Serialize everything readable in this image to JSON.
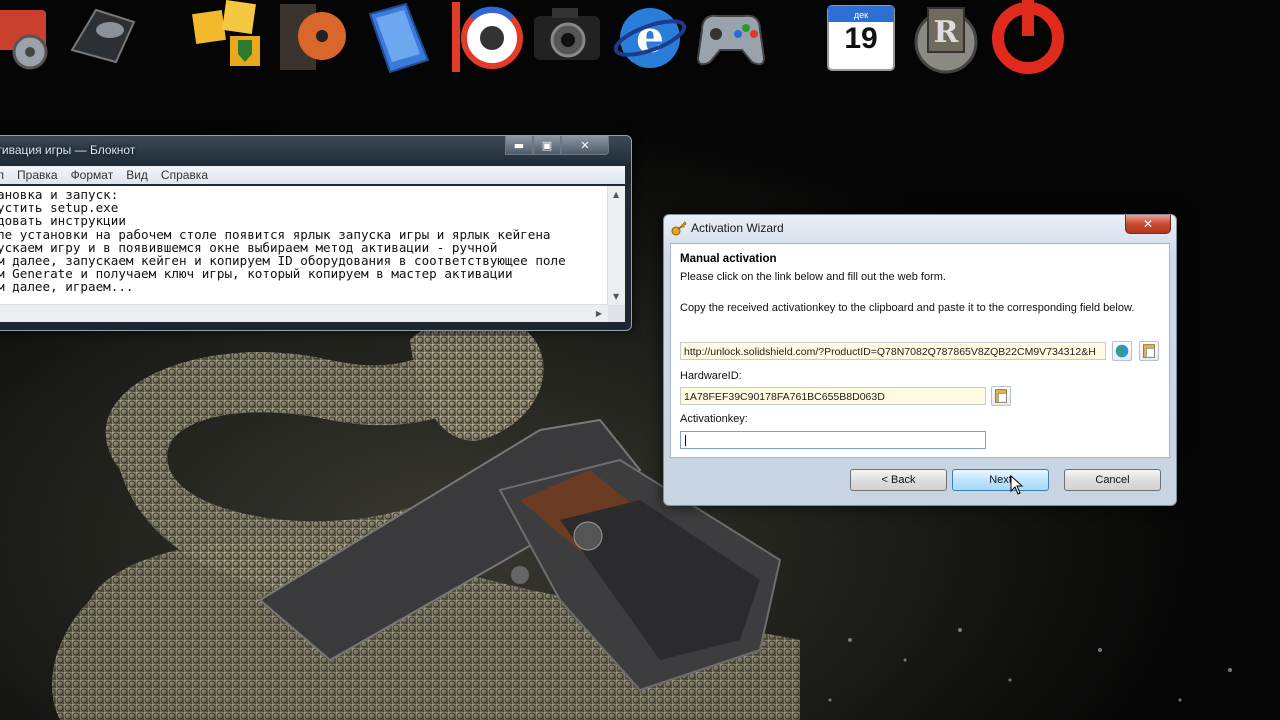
{
  "desktop": {
    "dock": [
      {
        "name": "system-tools-icon"
      },
      {
        "name": "disk-drive-icon"
      },
      {
        "name": "security-cubes-icon"
      },
      {
        "name": "dvd-burner-icon"
      },
      {
        "name": "documents-icon"
      },
      {
        "name": "media-player-icon"
      },
      {
        "name": "camera-icon"
      },
      {
        "name": "internet-explorer-icon"
      },
      {
        "name": "gamepad-icon"
      },
      {
        "name": "calendar-icon"
      },
      {
        "name": "registry-icon"
      },
      {
        "name": "power-icon"
      }
    ],
    "calendar": {
      "month": "дек",
      "day": "19"
    }
  },
  "notepad": {
    "title": "ктивация игры — Блокнот",
    "menu": [
      "л",
      "Правка",
      "Формат",
      "Вид",
      "Справка"
    ],
    "lines": [
      "ановка и запуск:",
      "устить setup.exe",
      "довать инструкции",
      "ле установки на рабочем столе появится ярлык запуска игры и ярлык кейгена",
      "ускаем игру и в появившемся окне выбираем метод активации - ручной",
      "м далее, запускаем кейген и копируем ID оборудования в соответствующее поле",
      "м Generate и получаем ключ игры, который копируем в мастер активации",
      "м далее, играем..."
    ],
    "controls": {
      "minimize": "▬",
      "maximize": "▣",
      "close": "✕"
    }
  },
  "wizard": {
    "title": "Activation Wizard",
    "close": "✕",
    "heading": "Manual activation",
    "instruction1": "Please click on the link below and fill out the web form.",
    "instruction2": "Copy the received activationkey to the clipboard and paste it to the corresponding field below.",
    "url": "http://unlock.solidshield.com/?ProductID=Q78N7082Q787865V8ZQB22CM9V734312&H",
    "hardware_label": "HardwareID:",
    "hardware_id": "1A78FEF39C90178FA761BC655B8D063D",
    "activation_label": "Activationkey:",
    "activation_key": "",
    "buttons": {
      "back": "< Back",
      "next": "Next",
      "cancel": "Cancel"
    }
  }
}
